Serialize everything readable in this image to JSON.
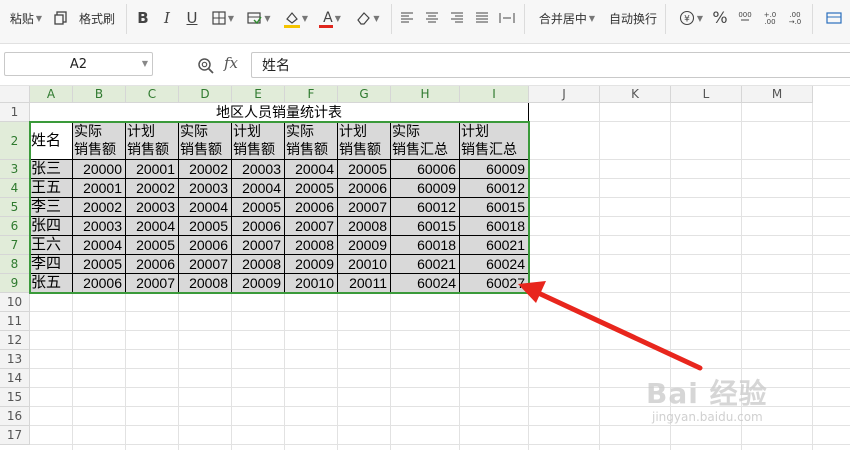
{
  "ribbon": {
    "paste_label": "粘贴",
    "format_painter_label": "格式刷",
    "merge_center_label": "合并居中",
    "wrap_text_label": "自动换行",
    "percent_symbol": "%"
  },
  "formula_bar": {
    "cell_ref": "A2",
    "fx_symbol": "fx",
    "content": "姓名"
  },
  "grid": {
    "columns": [
      "A",
      "B",
      "C",
      "D",
      "E",
      "F",
      "G",
      "H",
      "I",
      "J",
      "K",
      "L",
      "M"
    ],
    "rows": [
      "1",
      "2",
      "3",
      "4",
      "5",
      "6",
      "7",
      "8",
      "9",
      "10",
      "11",
      "12",
      "13",
      "14",
      "15",
      "16",
      "17"
    ],
    "title": "地区人员销量统计表",
    "header_row": [
      {
        "line1": "姓名",
        "line2": ""
      },
      {
        "line1": "实际",
        "line2": "销售额"
      },
      {
        "line1": "计划",
        "line2": "销售额"
      },
      {
        "line1": "实际",
        "line2": "销售额"
      },
      {
        "line1": "计划",
        "line2": "销售额"
      },
      {
        "line1": "实际",
        "line2": "销售额"
      },
      {
        "line1": "计划",
        "line2": "销售额"
      },
      {
        "line1": "实际",
        "line2": "销售汇总"
      },
      {
        "line1": "计划",
        "line2": "销售汇总"
      }
    ],
    "data_rows": [
      [
        "张三",
        "20000",
        "20001",
        "20002",
        "20003",
        "20004",
        "20005",
        "60006",
        "60009"
      ],
      [
        "王五",
        "20001",
        "20002",
        "20003",
        "20004",
        "20005",
        "20006",
        "60009",
        "60012"
      ],
      [
        "李三",
        "20002",
        "20003",
        "20004",
        "20005",
        "20006",
        "20007",
        "60012",
        "60015"
      ],
      [
        "张四",
        "20003",
        "20004",
        "20005",
        "20006",
        "20007",
        "20008",
        "60015",
        "60018"
      ],
      [
        "王六",
        "20004",
        "20005",
        "20006",
        "20007",
        "20008",
        "20009",
        "60018",
        "60021"
      ],
      [
        "李四",
        "20005",
        "20006",
        "20007",
        "20008",
        "20009",
        "20010",
        "60021",
        "60024"
      ],
      [
        "张五",
        "20006",
        "20007",
        "20008",
        "20009",
        "20010",
        "20011",
        "60024",
        "60027"
      ]
    ]
  },
  "watermark": {
    "main": "Bai 经验",
    "sub": "jingyan.baidu.com"
  },
  "colors": {
    "selection_border": "#3a9a3a",
    "cell_fill": "#d9d9d9",
    "arrow": "#e8261d"
  }
}
